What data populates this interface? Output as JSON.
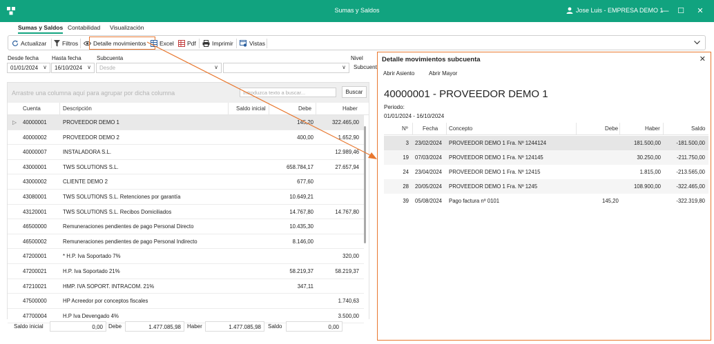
{
  "titlebar": {
    "title": "Sumas y Saldos",
    "user": "Jose Luis - EMPRESA DEMO 1",
    "minimize": "—",
    "maximize": "☐",
    "close": "✕",
    "accent": "#11a37f"
  },
  "tabs": [
    {
      "label": "Sumas y Saldos",
      "active": true
    },
    {
      "label": "Contabilidad",
      "active": false
    },
    {
      "label": "Visualización",
      "active": false
    }
  ],
  "toolbar": {
    "actualizar": "Actualizar",
    "filtros": "Filtros",
    "detalle": "Detalle movimientos",
    "excel": "Excel",
    "pdf": "Pdf",
    "imprimir": "Imprimir",
    "vistas": "Vistas"
  },
  "filters": {
    "desde_label": "Desde fecha",
    "desde_value": "01/01/2024",
    "hasta_label": "Hasta fecha",
    "hasta_value": "16/10/2024",
    "subcuenta_label": "Subcuenta",
    "subcuenta_placeholder": "Desde",
    "nivel_label": "Nivel",
    "nivel_value": "Subcuent"
  },
  "grid": {
    "group_hint": "Arrastre una columna aquí para agrupar por dicha columna",
    "search_placeholder": "Introduzca texto a buscar...",
    "search_button": "Buscar",
    "columns": [
      "Cuenta",
      "Descripción",
      "Saldo inicial",
      "Debe",
      "Haber"
    ],
    "rows": [
      {
        "cuenta": "40000001",
        "descripcion": "PROVEEDOR DEMO 1",
        "saldo": "",
        "debe": "145,20",
        "haber": "322.465,00"
      },
      {
        "cuenta": "40000002",
        "descripcion": "PROVEEDOR DEMO 2",
        "saldo": "",
        "debe": "400,00",
        "haber": "1.652,90"
      },
      {
        "cuenta": "40000007",
        "descripcion": "INSTALADORA S.L.",
        "saldo": "",
        "debe": "",
        "haber": "12.989,46"
      },
      {
        "cuenta": "43000001",
        "descripcion": "TWS SOLUTIONS S.L.",
        "saldo": "",
        "debe": "658.784,17",
        "haber": "27.657,94"
      },
      {
        "cuenta": "43000002",
        "descripcion": "CLIENTE DEMO 2",
        "saldo": "",
        "debe": "677,60",
        "haber": ""
      },
      {
        "cuenta": "43080001",
        "descripcion": "TWS SOLUTIONS S.L. Retenciones por garantía",
        "saldo": "",
        "debe": "10.649,21",
        "haber": ""
      },
      {
        "cuenta": "43120001",
        "descripcion": "TWS SOLUTIONS S.L. Recibos Domiciliados",
        "saldo": "",
        "debe": "14.767,80",
        "haber": "14.767,80"
      },
      {
        "cuenta": "46500000",
        "descripcion": "Remuneraciones pendientes de pago Personal Directo",
        "saldo": "",
        "debe": "10.435,30",
        "haber": ""
      },
      {
        "cuenta": "46500002",
        "descripcion": "Remuneraciones pendientes de pago Personal Indirecto",
        "saldo": "",
        "debe": "8.146,00",
        "haber": ""
      },
      {
        "cuenta": "47200001",
        "descripcion": "* H.P. Iva Soportado 7%",
        "saldo": "",
        "debe": "",
        "haber": "320,00"
      },
      {
        "cuenta": "47200021",
        "descripcion": "H.P. Iva Soportado 21%",
        "saldo": "",
        "debe": "58.219,37",
        "haber": "58.219,37"
      },
      {
        "cuenta": "47210021",
        "descripcion": "HMP. IVA SOPORT. INTRACOM. 21%",
        "saldo": "",
        "debe": "347,11",
        "haber": ""
      },
      {
        "cuenta": "47500000",
        "descripcion": "HP Acreedor por conceptos fiscales",
        "saldo": "",
        "debe": "",
        "haber": "1.740,63"
      },
      {
        "cuenta": "47700004",
        "descripcion": "H.P Iva Devengado 4%",
        "saldo": "",
        "debe": "",
        "haber": "3.500,00"
      }
    ]
  },
  "footer": {
    "saldo_inicial_label": "Saldo inicial",
    "saldo_inicial_value": "0,00",
    "debe_label": "Debe",
    "debe_value": "1.477.085,98",
    "haber_label": "Haber",
    "haber_value": "1.477.085,98",
    "saldo_label": "Saldo",
    "saldo_value": "0,00"
  },
  "panel": {
    "title": "Detalle movimientos subcuenta",
    "close": "✕",
    "abrir_asiento": "Abrir Asiento",
    "abrir_mayor": "Abrir Mayor",
    "account": "40000001 - PROVEEDOR DEMO 1",
    "periodo_label": "Periodo:",
    "periodo_value": "01/01/2024 - 16/10/2024",
    "columns": [
      "Nº",
      "Fecha",
      "Concepto",
      "Debe",
      "Haber",
      "Saldo"
    ],
    "rows": [
      {
        "n": "3",
        "fecha": "23/02/2024",
        "concepto": "PROVEEDOR DEMO 1 Fra. Nº 1244124",
        "debe": "",
        "haber": "181.500,00",
        "saldo": "-181.500,00"
      },
      {
        "n": "19",
        "fecha": "07/03/2024",
        "concepto": "PROVEEDOR DEMO 1 Fra. Nº 124145",
        "debe": "",
        "haber": "30.250,00",
        "saldo": "-211.750,00"
      },
      {
        "n": "24",
        "fecha": "23/04/2024",
        "concepto": "PROVEEDOR DEMO 1 Fra. Nº 12415",
        "debe": "",
        "haber": "1.815,00",
        "saldo": "-213.565,00"
      },
      {
        "n": "28",
        "fecha": "20/05/2024",
        "concepto": "PROVEEDOR DEMO 1 Fra. Nº 1245",
        "debe": "",
        "haber": "108.900,00",
        "saldo": "-322.465,00"
      },
      {
        "n": "39",
        "fecha": "05/08/2024",
        "concepto": "Pago factura nº 0101",
        "debe": "145,20",
        "haber": "",
        "saldo": "-322.319,80"
      }
    ]
  },
  "highlight_color": "#e8772e"
}
